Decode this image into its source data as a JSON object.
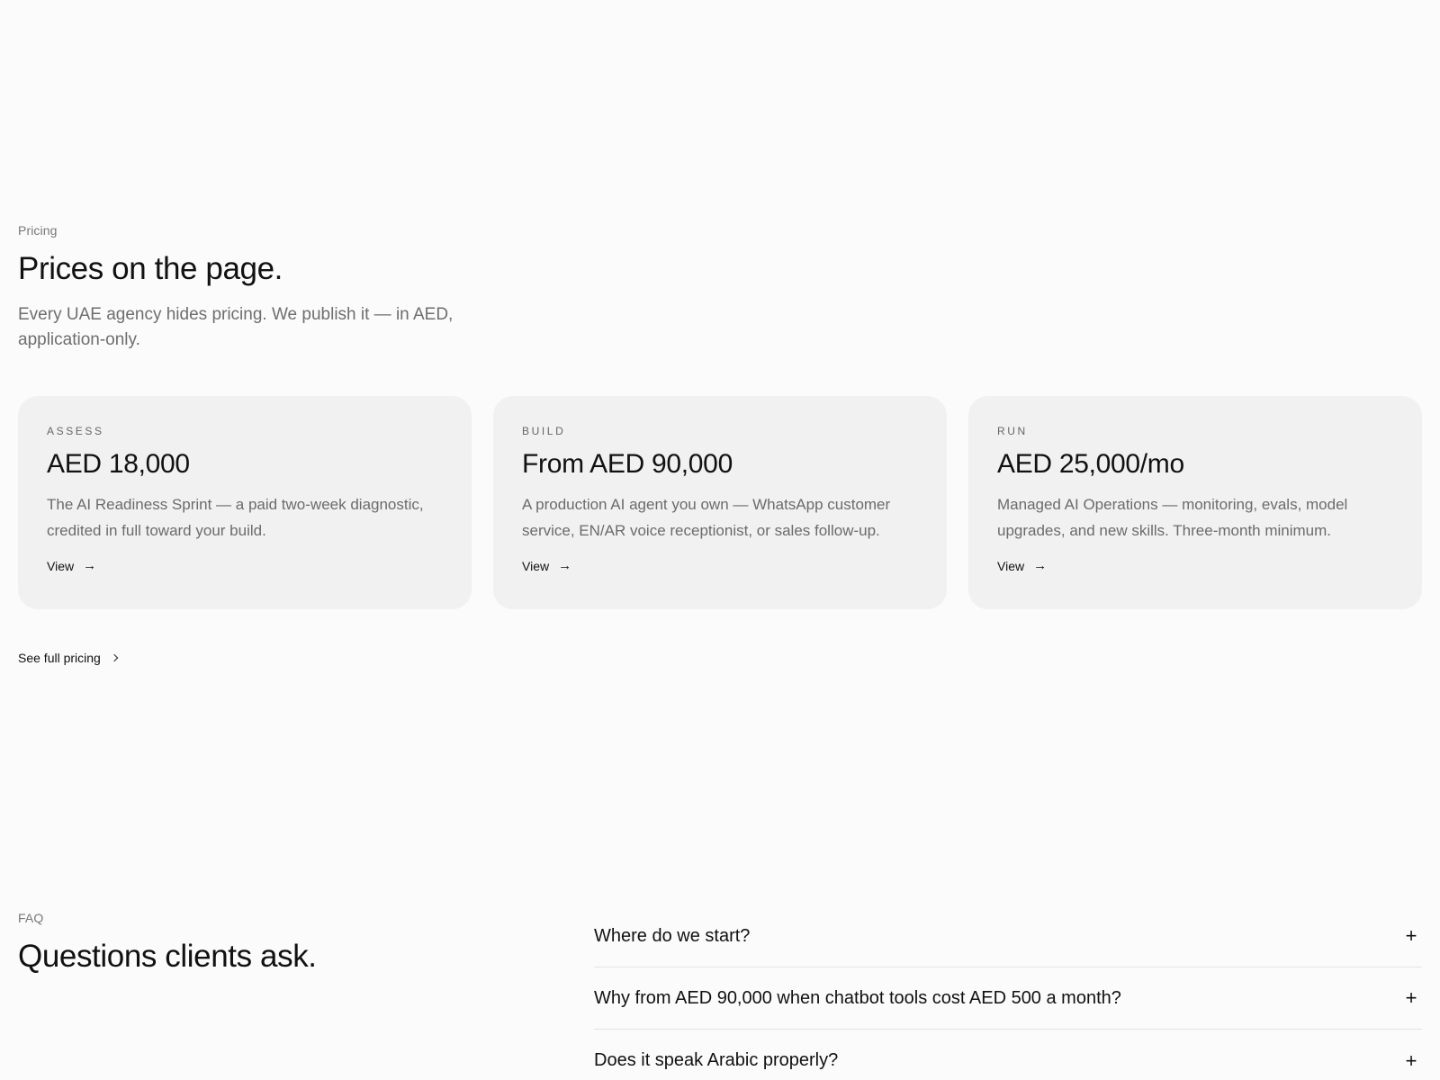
{
  "pricing": {
    "eyebrow": "Pricing",
    "title": "Prices on the page.",
    "lead": "Every UAE agency hides pricing. We publish it — in AED, application-only.",
    "cards": [
      {
        "tier": "ASSESS",
        "price": "AED 18,000",
        "description": "The AI Readiness Sprint — a paid two-week diagnostic, credited in full toward your build.",
        "link_label": "View"
      },
      {
        "tier": "BUILD",
        "price": "From AED 90,000",
        "description": "A production AI agent you own — WhatsApp customer service, EN/AR voice receptionist, or sales follow-up.",
        "link_label": "View"
      },
      {
        "tier": "RUN",
        "price": "AED 25,000/mo",
        "description": "Managed AI Operations — monitoring, evals, model upgrades, and new skills. Three-month minimum.",
        "link_label": "View"
      }
    ],
    "full_pricing_label": "See full pricing"
  },
  "faq": {
    "eyebrow": "FAQ",
    "title": "Questions clients ask.",
    "items": [
      {
        "question": "Where do we start?"
      },
      {
        "question": "Why from AED 90,000 when chatbot tools cost AED 500 a month?"
      },
      {
        "question": "Does it speak Arabic properly?"
      }
    ]
  },
  "icons": {
    "arrow": "arrow-right-icon",
    "chevron": "chevron-right-icon",
    "expand": "plus-icon"
  },
  "colors": {
    "background": "#fbfbfb",
    "card": "#f1f1f1",
    "text": "#111111",
    "muted": "#6e6e6e"
  }
}
